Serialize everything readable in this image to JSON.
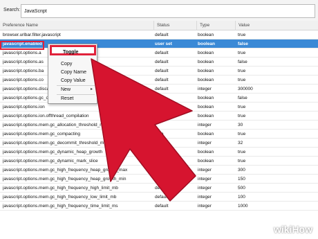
{
  "search": {
    "label": "Search:",
    "value": "JavaScript"
  },
  "columns": [
    "Preference Name",
    "Status",
    "Type",
    "Value"
  ],
  "rows": [
    {
      "name": "browser.urlbar.filter.javascript",
      "status": "default",
      "type": "boolean",
      "value": "true",
      "selected": false
    },
    {
      "name": "javascript.enabled",
      "status": "user set",
      "type": "boolean",
      "value": "false",
      "selected": true
    },
    {
      "name": "javascript.options.a",
      "status": "default",
      "type": "boolean",
      "value": "true",
      "selected": false
    },
    {
      "name": "javascript.options.as",
      "status": "default",
      "type": "boolean",
      "value": "false",
      "selected": false
    },
    {
      "name": "javascript.options.ba",
      "status": "default",
      "type": "boolean",
      "value": "true",
      "selected": false
    },
    {
      "name": "javascript.options.co",
      "status": "default",
      "type": "boolean",
      "value": "true",
      "selected": false
    },
    {
      "name": "javascript.options.discardSystemSource",
      "status": "default",
      "type": "integer",
      "value": "300000",
      "selected": false
    },
    {
      "name": "javascript.options.gc_on_memory_pressure",
      "status": "",
      "type": "boolean",
      "value": "false",
      "selected": false
    },
    {
      "name": "javascript.options.ion",
      "status": "",
      "type": "boolean",
      "value": "true",
      "selected": false
    },
    {
      "name": "javascript.options.ion.offthread_compilation",
      "status": "",
      "type": "boolean",
      "value": "true",
      "selected": false
    },
    {
      "name": "javascript.options.mem.gc_allocation_threshold_mb",
      "status": "",
      "type": "integer",
      "value": "30",
      "selected": false
    },
    {
      "name": "javascript.options.mem.gc_compacting",
      "status": "defa",
      "type": "boolean",
      "value": "true",
      "selected": false
    },
    {
      "name": "javascript.options.mem.gc_decommit_threshold_mb",
      "status": "defa",
      "type": "integer",
      "value": "32",
      "selected": false
    },
    {
      "name": "javascript.options.mem.gc_dynamic_heap_growth",
      "status": "defa",
      "type": "boolean",
      "value": "true",
      "selected": false
    },
    {
      "name": "javascript.options.mem.gc_dynamic_mark_slice",
      "status": "defa",
      "type": "boolean",
      "value": "true",
      "selected": false
    },
    {
      "name": "javascript.options.mem.gc_high_frequency_heap_growth_max",
      "status": "default",
      "type": "integer",
      "value": "300",
      "selected": false
    },
    {
      "name": "javascript.options.mem.gc_high_frequency_heap_growth_min",
      "status": "default",
      "type": "integer",
      "value": "150",
      "selected": false
    },
    {
      "name": "javascript.options.mem.gc_high_frequency_high_limit_mb",
      "status": "default",
      "type": "integer",
      "value": "500",
      "selected": false
    },
    {
      "name": "javascript.options.mem.gc_high_frequency_low_limit_mb",
      "status": "default",
      "type": "integer",
      "value": "100",
      "selected": false
    },
    {
      "name": "javascript.options.mem.gc_high_frequency_time_limit_ms",
      "status": "default",
      "type": "integer",
      "value": "1000",
      "selected": false
    }
  ],
  "context_menu": {
    "toggle": "Toggle",
    "copy": "Copy",
    "copy_name": "Copy Name",
    "copy_value": "Copy Value",
    "new": "New",
    "reset": "Reset",
    "submenu_arrow": "▸"
  },
  "colors": {
    "selected_row": "#3a89d6",
    "highlight": "#e0213a",
    "arrow": "#d6142f"
  },
  "watermark": "wikiHow"
}
